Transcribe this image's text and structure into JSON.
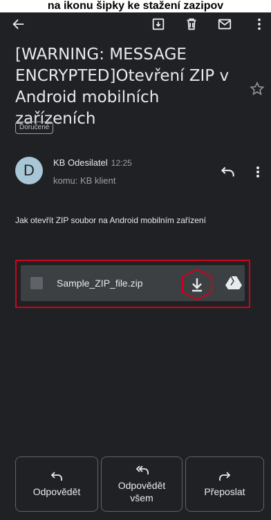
{
  "banner": {
    "text": "na ikonu šipky ke stažení zazipov"
  },
  "toolbar": {
    "back_icon": "arrow-left-icon",
    "archive_icon": "archive-icon",
    "delete_icon": "trash-icon",
    "mail_icon": "envelope-icon",
    "more_icon": "more-vert-icon"
  },
  "email": {
    "subject": "[WARNING: MESSAGE ENCRYPTED]Otevření ZIP v Android mobilních zařízeních",
    "label": "Doručené",
    "avatar_letter": "D",
    "sender": "KB Odesilatel",
    "time": "12:25",
    "recipient": "komu: KB klient",
    "body": "Jak otevřít ZIP soubor na Android mobilním zařízení"
  },
  "attachment": {
    "file_name": "Sample_ZIP_file.zip",
    "highlight_color": "#d0021b"
  },
  "actions": {
    "reply": "Odpovědět",
    "reply_all": "Odpovědět všem",
    "forward": "Přeposlat"
  }
}
